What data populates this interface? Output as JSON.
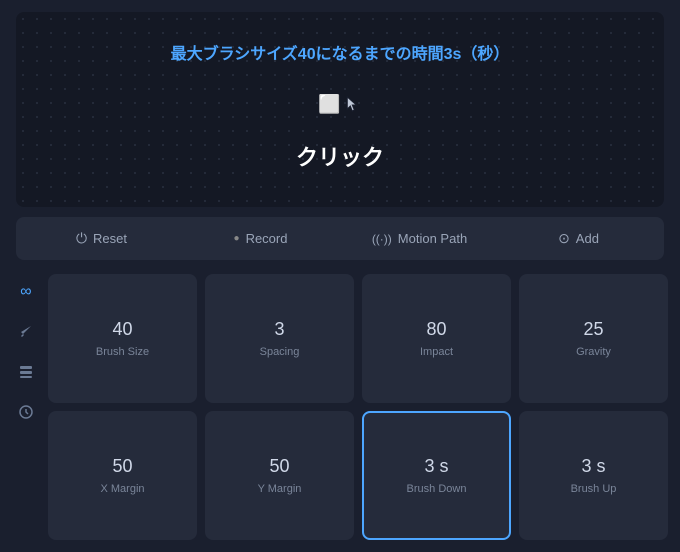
{
  "preview": {
    "topText": "最大ブラシサイズ40になるまでの時間3s（秒）",
    "clickText": "クリック"
  },
  "toolbar": {
    "reset": "Reset",
    "record": "Record",
    "motionPath": "Motion Path",
    "add": "Add"
  },
  "sidebar": {
    "icons": [
      "∞",
      "✦",
      "▣",
      "◷"
    ]
  },
  "grid": {
    "row1": [
      {
        "value": "40",
        "label": "Brush Size"
      },
      {
        "value": "3",
        "label": "Spacing"
      },
      {
        "value": "80",
        "label": "Impact"
      },
      {
        "value": "25",
        "label": "Gravity"
      }
    ],
    "row2": [
      {
        "value": "50",
        "label": "X Margin"
      },
      {
        "value": "50",
        "label": "Y Margin"
      },
      {
        "value": "3 s",
        "label": "Brush Down",
        "active": true
      },
      {
        "value": "3 s",
        "label": "Brush Up"
      }
    ]
  }
}
